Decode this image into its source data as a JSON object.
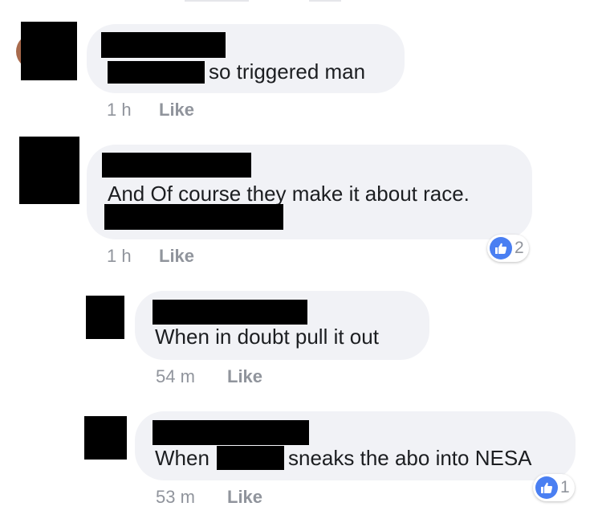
{
  "comments": [
    {
      "text": "so triggered man",
      "time": "1 h",
      "like_label": "Like"
    },
    {
      "text": "And Of course they make it about race.",
      "time": "1 h",
      "like_label": "Like",
      "reaction": {
        "icon": "thumbs-up-icon",
        "count": "2"
      }
    },
    {
      "text": "When in doubt pull it out",
      "time": "54 m",
      "like_label": "Like"
    },
    {
      "text_before": "When",
      "text_after": "sneaks the abo into NESA",
      "time": "53 m",
      "like_label": "Like",
      "reaction": {
        "icon": "thumbs-up-icon",
        "count": "1"
      }
    }
  ],
  "colors": {
    "bubble": "#f1f2f6",
    "text": "#1c1e21",
    "meta": "#90949c",
    "reaction_blue": "#4a7ff2"
  }
}
